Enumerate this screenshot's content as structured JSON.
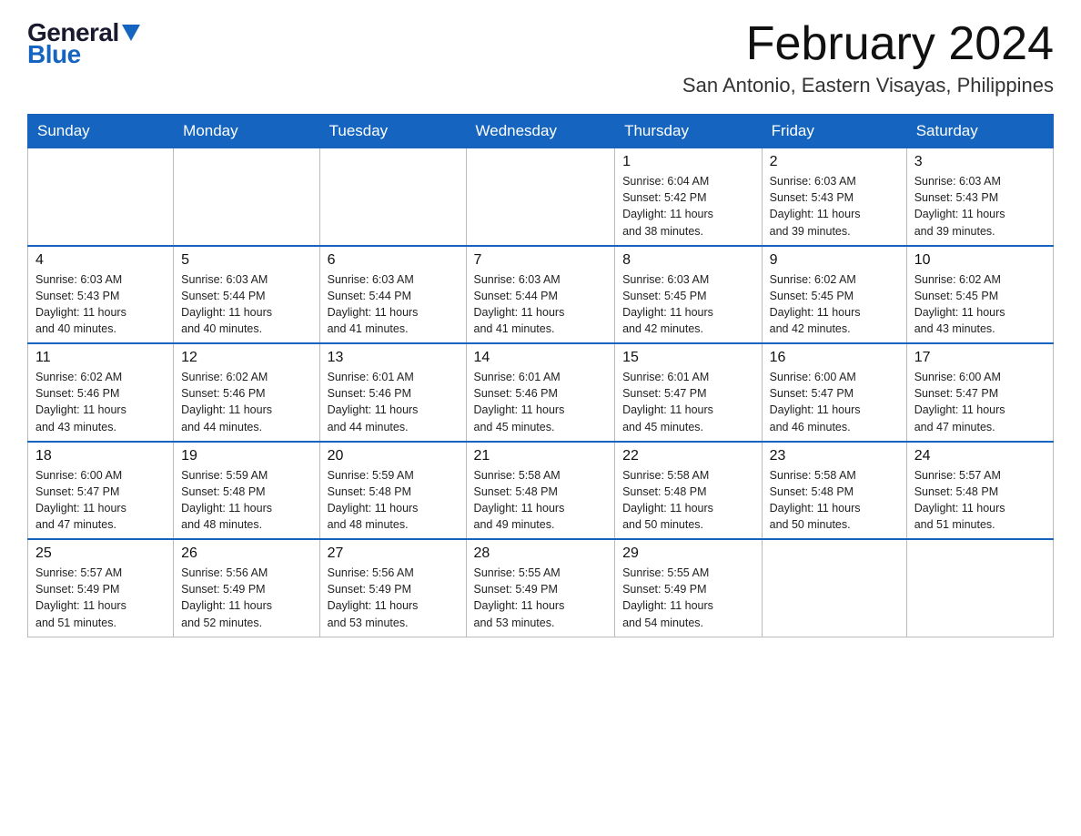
{
  "logo": {
    "general": "General",
    "blue": "Blue"
  },
  "title": "February 2024",
  "location": "San Antonio, Eastern Visayas, Philippines",
  "weekdays": [
    "Sunday",
    "Monday",
    "Tuesday",
    "Wednesday",
    "Thursday",
    "Friday",
    "Saturday"
  ],
  "weeks": [
    [
      {
        "day": "",
        "info": ""
      },
      {
        "day": "",
        "info": ""
      },
      {
        "day": "",
        "info": ""
      },
      {
        "day": "",
        "info": ""
      },
      {
        "day": "1",
        "info": "Sunrise: 6:04 AM\nSunset: 5:42 PM\nDaylight: 11 hours\nand 38 minutes."
      },
      {
        "day": "2",
        "info": "Sunrise: 6:03 AM\nSunset: 5:43 PM\nDaylight: 11 hours\nand 39 minutes."
      },
      {
        "day": "3",
        "info": "Sunrise: 6:03 AM\nSunset: 5:43 PM\nDaylight: 11 hours\nand 39 minutes."
      }
    ],
    [
      {
        "day": "4",
        "info": "Sunrise: 6:03 AM\nSunset: 5:43 PM\nDaylight: 11 hours\nand 40 minutes."
      },
      {
        "day": "5",
        "info": "Sunrise: 6:03 AM\nSunset: 5:44 PM\nDaylight: 11 hours\nand 40 minutes."
      },
      {
        "day": "6",
        "info": "Sunrise: 6:03 AM\nSunset: 5:44 PM\nDaylight: 11 hours\nand 41 minutes."
      },
      {
        "day": "7",
        "info": "Sunrise: 6:03 AM\nSunset: 5:44 PM\nDaylight: 11 hours\nand 41 minutes."
      },
      {
        "day": "8",
        "info": "Sunrise: 6:03 AM\nSunset: 5:45 PM\nDaylight: 11 hours\nand 42 minutes."
      },
      {
        "day": "9",
        "info": "Sunrise: 6:02 AM\nSunset: 5:45 PM\nDaylight: 11 hours\nand 42 minutes."
      },
      {
        "day": "10",
        "info": "Sunrise: 6:02 AM\nSunset: 5:45 PM\nDaylight: 11 hours\nand 43 minutes."
      }
    ],
    [
      {
        "day": "11",
        "info": "Sunrise: 6:02 AM\nSunset: 5:46 PM\nDaylight: 11 hours\nand 43 minutes."
      },
      {
        "day": "12",
        "info": "Sunrise: 6:02 AM\nSunset: 5:46 PM\nDaylight: 11 hours\nand 44 minutes."
      },
      {
        "day": "13",
        "info": "Sunrise: 6:01 AM\nSunset: 5:46 PM\nDaylight: 11 hours\nand 44 minutes."
      },
      {
        "day": "14",
        "info": "Sunrise: 6:01 AM\nSunset: 5:46 PM\nDaylight: 11 hours\nand 45 minutes."
      },
      {
        "day": "15",
        "info": "Sunrise: 6:01 AM\nSunset: 5:47 PM\nDaylight: 11 hours\nand 45 minutes."
      },
      {
        "day": "16",
        "info": "Sunrise: 6:00 AM\nSunset: 5:47 PM\nDaylight: 11 hours\nand 46 minutes."
      },
      {
        "day": "17",
        "info": "Sunrise: 6:00 AM\nSunset: 5:47 PM\nDaylight: 11 hours\nand 47 minutes."
      }
    ],
    [
      {
        "day": "18",
        "info": "Sunrise: 6:00 AM\nSunset: 5:47 PM\nDaylight: 11 hours\nand 47 minutes."
      },
      {
        "day": "19",
        "info": "Sunrise: 5:59 AM\nSunset: 5:48 PM\nDaylight: 11 hours\nand 48 minutes."
      },
      {
        "day": "20",
        "info": "Sunrise: 5:59 AM\nSunset: 5:48 PM\nDaylight: 11 hours\nand 48 minutes."
      },
      {
        "day": "21",
        "info": "Sunrise: 5:58 AM\nSunset: 5:48 PM\nDaylight: 11 hours\nand 49 minutes."
      },
      {
        "day": "22",
        "info": "Sunrise: 5:58 AM\nSunset: 5:48 PM\nDaylight: 11 hours\nand 50 minutes."
      },
      {
        "day": "23",
        "info": "Sunrise: 5:58 AM\nSunset: 5:48 PM\nDaylight: 11 hours\nand 50 minutes."
      },
      {
        "day": "24",
        "info": "Sunrise: 5:57 AM\nSunset: 5:48 PM\nDaylight: 11 hours\nand 51 minutes."
      }
    ],
    [
      {
        "day": "25",
        "info": "Sunrise: 5:57 AM\nSunset: 5:49 PM\nDaylight: 11 hours\nand 51 minutes."
      },
      {
        "day": "26",
        "info": "Sunrise: 5:56 AM\nSunset: 5:49 PM\nDaylight: 11 hours\nand 52 minutes."
      },
      {
        "day": "27",
        "info": "Sunrise: 5:56 AM\nSunset: 5:49 PM\nDaylight: 11 hours\nand 53 minutes."
      },
      {
        "day": "28",
        "info": "Sunrise: 5:55 AM\nSunset: 5:49 PM\nDaylight: 11 hours\nand 53 minutes."
      },
      {
        "day": "29",
        "info": "Sunrise: 5:55 AM\nSunset: 5:49 PM\nDaylight: 11 hours\nand 54 minutes."
      },
      {
        "day": "",
        "info": ""
      },
      {
        "day": "",
        "info": ""
      }
    ]
  ]
}
